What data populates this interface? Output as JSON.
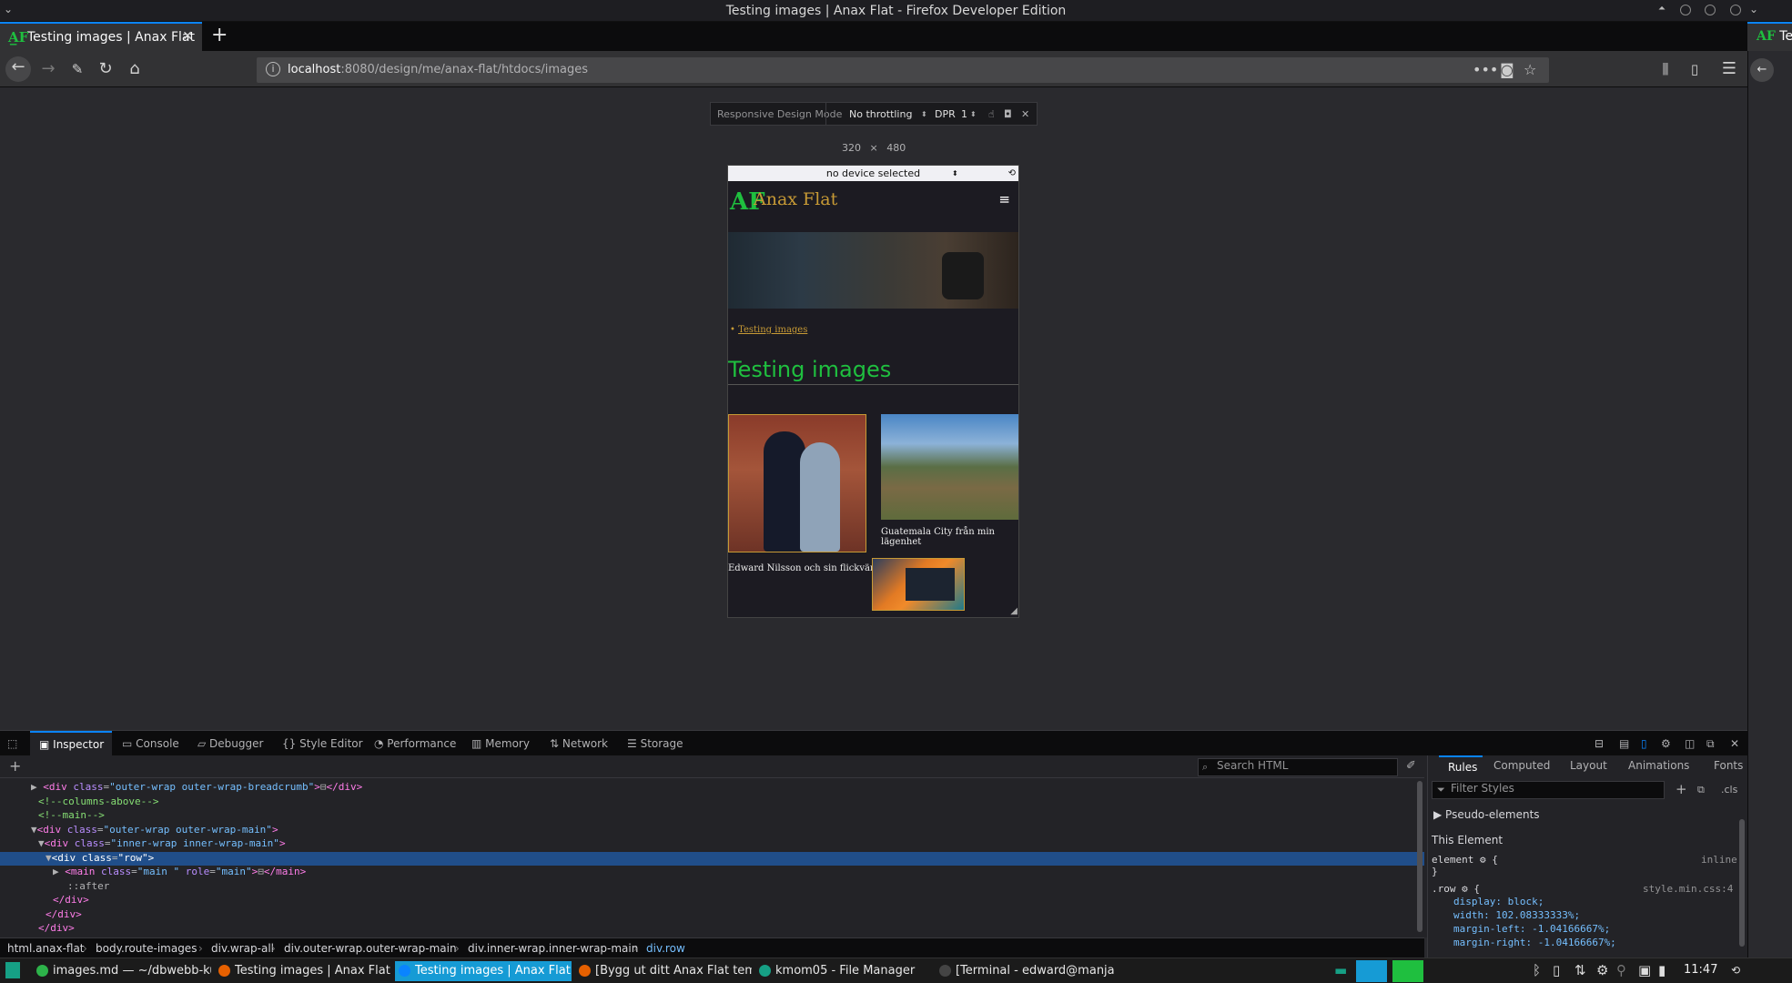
{
  "window": {
    "title": "Testing images | Anax Flat - Firefox Developer Edition"
  },
  "tabs": [
    {
      "label": "Testing images | Anax Flat",
      "active": true
    }
  ],
  "side_tab_label": "Tes",
  "url": {
    "host": "localhost",
    "rest": ":8080/design/me/anax-flat/htdocs/images"
  },
  "rdm": {
    "label": "Responsive Design Mode",
    "throttling": "No throttling",
    "dpr_label": "DPR",
    "dpr_value": "1",
    "width": "320",
    "times": "×",
    "height": "480",
    "device": "no device selected"
  },
  "site": {
    "logo": "AF",
    "title": "Anax Flat",
    "breadcrumb": "Testing images",
    "heading": "Testing images",
    "captions": [
      "Edward Nilsson och sin flickvän",
      "Guatemala City från min lägenhet"
    ]
  },
  "devtools": {
    "tabs": [
      "Inspector",
      "Console",
      "Debugger",
      "Style Editor",
      "Performance",
      "Memory",
      "Network",
      "Storage"
    ],
    "active_tab": "Inspector",
    "search_placeholder": "Search HTML",
    "markup": [
      {
        "indent": 4,
        "parts": [
          [
            "pl",
            "▶ "
          ],
          [
            "tg",
            "<div "
          ],
          [
            "at",
            "class"
          ],
          [
            "pl",
            "="
          ],
          [
            "av",
            "\"outer-wrap outer-wrap-breadcrumb\""
          ],
          [
            "tg",
            ">"
          ],
          [
            "pl",
            "⊟"
          ],
          [
            "tg",
            "</div>"
          ]
        ]
      },
      {
        "indent": 5,
        "parts": [
          [
            "cm",
            "<!--columns-above-->"
          ]
        ]
      },
      {
        "indent": 5,
        "parts": [
          [
            "cm",
            "<!--main-->"
          ]
        ]
      },
      {
        "indent": 4,
        "parts": [
          [
            "pl",
            "▼"
          ],
          [
            "tg",
            "<div "
          ],
          [
            "at",
            "class"
          ],
          [
            "pl",
            "="
          ],
          [
            "av",
            "\"outer-wrap outer-wrap-main\""
          ],
          [
            "tg",
            ">"
          ]
        ]
      },
      {
        "indent": 5,
        "parts": [
          [
            "pl",
            "▼"
          ],
          [
            "tg",
            "<div "
          ],
          [
            "at",
            "class"
          ],
          [
            "pl",
            "="
          ],
          [
            "av",
            "\"inner-wrap inner-wrap-main\""
          ],
          [
            "tg",
            ">"
          ]
        ]
      },
      {
        "indent": 6,
        "parts": [
          [
            "pl",
            "▼"
          ],
          [
            "tg",
            "<div "
          ],
          [
            "at",
            "class"
          ],
          [
            "pl",
            "="
          ],
          [
            "av",
            "\"row\""
          ],
          [
            "tg",
            ">"
          ]
        ],
        "selected": true
      },
      {
        "indent": 7,
        "parts": [
          [
            "pl",
            "▶ "
          ],
          [
            "tg",
            "<main "
          ],
          [
            "at",
            "class"
          ],
          [
            "pl",
            "="
          ],
          [
            "av",
            "\"main \""
          ],
          [
            "pl",
            " "
          ],
          [
            "at",
            "role"
          ],
          [
            "pl",
            "="
          ],
          [
            "av",
            "\"main\""
          ],
          [
            "tg",
            ">"
          ],
          [
            "pl",
            "⊟"
          ],
          [
            "tg",
            "</main>"
          ]
        ]
      },
      {
        "indent": 9,
        "parts": [
          [
            "pl",
            "::after"
          ]
        ]
      },
      {
        "indent": 7,
        "parts": [
          [
            "tg",
            "</div>"
          ]
        ]
      },
      {
        "indent": 6,
        "parts": [
          [
            "tg",
            "</div>"
          ]
        ]
      },
      {
        "indent": 5,
        "parts": [
          [
            "tg",
            "</div>"
          ]
        ]
      }
    ],
    "breadcrumb": [
      "html.anax-flat",
      "body.route-images",
      "div.wrap-all",
      "div.outer-wrap.outer-wrap-main",
      "div.inner-wrap.inner-wrap-main",
      "div.row"
    ],
    "rules_tabs": [
      "Rules",
      "Computed",
      "Layout",
      "Animations",
      "Fonts"
    ],
    "filter_placeholder": "Filter Styles",
    "cls_label": ".cls",
    "pseudo_elements": "Pseudo-elements",
    "this_element": "This Element",
    "element_rule": "element",
    "inline_label": "inline",
    "row_selector": ".row",
    "row_source": "style.min.css:4",
    "row_decls": [
      "display: block;",
      "width: 102.08333333%;",
      "margin-left: -1.04166667%;",
      "margin-right: -1.04166667%;"
    ]
  },
  "taskbar": {
    "items": [
      {
        "label": "images.md — ~/dbwebb-ku...",
        "color": "#2db34a"
      },
      {
        "label": "Testing images | Anax Flat ...",
        "color": "#e66000"
      },
      {
        "label": "Testing images | Anax Flat ...",
        "color": "#0a84ff",
        "active": true
      },
      {
        "label": "[Bygg ut ditt Anax Flat tem...",
        "color": "#e66000"
      },
      {
        "label": "kmom05 - File Manager",
        "color": "#16a085"
      },
      {
        "label": "[Terminal - edward@manja...",
        "color": "#444444"
      }
    ],
    "clock": "11:47"
  },
  "colors": {
    "accent": "#0a84ff",
    "site_green": "#1fbf3f",
    "site_gold": "#c79a35",
    "taskbar_active": "#169bd5"
  }
}
